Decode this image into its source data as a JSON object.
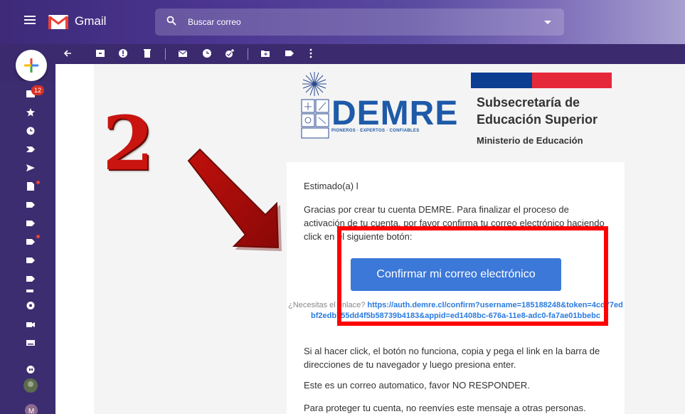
{
  "header": {
    "app_title": "Gmail",
    "search_placeholder": "Buscar correo"
  },
  "sidebar": {
    "inbox_badge": "12"
  },
  "email": {
    "sender_logo_text": "DEMRE",
    "sender_tagline": "PIONEROS · EXPERTOS · CONFIABLES",
    "org_title": "Subsecretaría de Educación Superior",
    "ministry": "Ministerio de Educación",
    "greeting": "Estimado(a) l",
    "intro": "Gracias por crear tu cuenta DEMRE. Para finalizar el proceso de activación de tu cuenta, por favor confirma tu correo electrónico haciendo click en el siguiente botón:",
    "confirm_button": "Confirmar mi correo electrónico",
    "link_question": "¿Necesitas el enlace?",
    "link_url": "https://auth.demre.cl/confirm?username=185188248&token=4cd77edbf2edb755dd4f5b58739b4183&appid=ed1408bc-676a-11e8-adc0-fa7ae01bbebc",
    "fallback": "Si al hacer click, el botón no funciona, copia y pega el link en la barra de direcciones de tu navegador y luego presiona enter.",
    "auto_notice": "Este es un correo automatico, favor NO RESPONDER.",
    "protect_notice": "Para proteger tu cuenta, no reenvíes este mensaje a otras personas."
  },
  "annotation": {
    "step_number": "2"
  },
  "colors": {
    "accent": "#3b78d8",
    "highlight": "#ff0000",
    "step": "#c9140f"
  }
}
